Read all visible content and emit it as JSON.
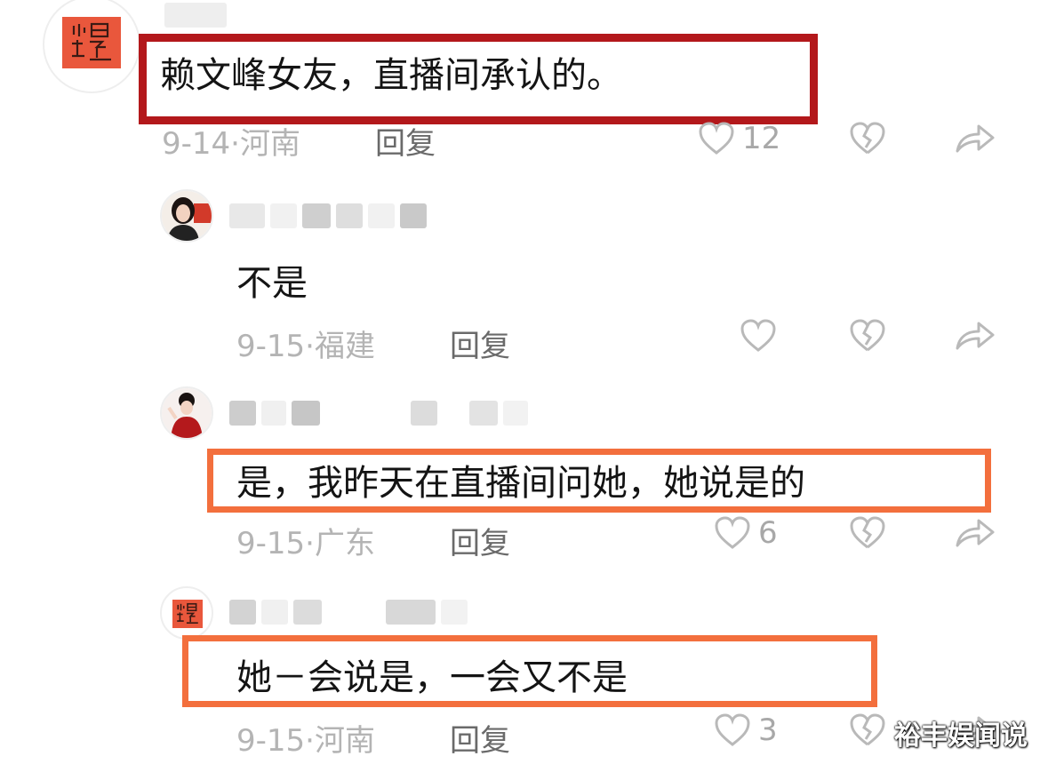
{
  "comments": [
    {
      "text": "赖文峰女友，直播间承认的。",
      "date": "9-14",
      "location": "河南",
      "reply_label": "回复",
      "likes": "12",
      "avatar_icon": "seal-avatar-icon",
      "highlight_color": "#b3181b"
    },
    {
      "text": "不是",
      "date": "9-15",
      "location": "福建",
      "reply_label": "回复",
      "likes": "",
      "avatar_icon": "woman-photo-avatar-icon"
    },
    {
      "text": "是，我昨天在直播间问她，她说是的",
      "date": "9-15",
      "location": "广东",
      "reply_label": "回复",
      "likes": "6",
      "avatar_icon": "woman-red-dress-avatar-icon",
      "highlight_color": "#f36f3d"
    },
    {
      "text": "她－会说是，一会又不是",
      "date": "9-15",
      "location": "河南",
      "reply_label": "回复",
      "likes": "3",
      "avatar_icon": "seal-avatar-icon",
      "highlight_color": "#f36f3d"
    }
  ],
  "meta_separator": "·",
  "watermark": "裕丰娱闻说",
  "icons": {
    "like": "heart-outline-icon",
    "dislike": "broken-heart-icon",
    "share": "share-arrow-icon"
  }
}
